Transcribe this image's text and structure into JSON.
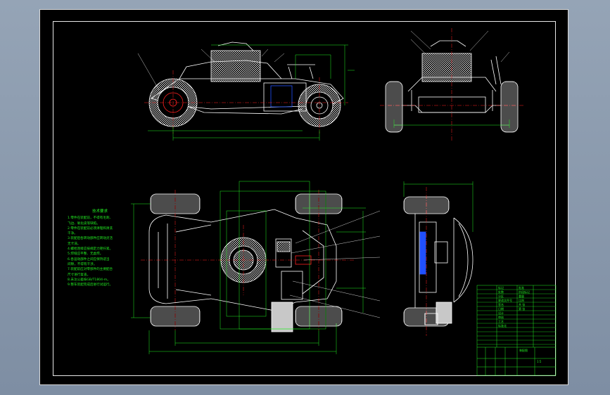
{
  "drawing": {
    "technical_notes": {
      "title": "技术要求",
      "lines": [
        "1.零件在装配前，不得有毛刺、",
        "  飞边、氧化皮等缺陷。",
        "2.零件在装配前必须清理和清洗",
        "  干净。",
        "3.装配后各转动部件应转动灵活",
        "  无卡滞。",
        "4.螺栓连接应按规定力矩拧紧。",
        "5.焊缝应平整、无虚焊。",
        "6.各运动部件之间应保持适当",
        "  间隙，不得有干涉。",
        "7.装配前应对零部件的主要配合",
        "  尺寸进行复查。",
        "8.未注公差按GB/T1804-m。",
        "9.整车装配完成后进行试运行。"
      ]
    },
    "title_block": {
      "labels": [
        "标记",
        "处数",
        "分区",
        "更改文件号",
        "签名",
        "日期",
        "设计",
        "审核",
        "工艺",
        "标准化",
        "批准",
        "阶段标记",
        "重量",
        "比例",
        "共 张",
        "第 张"
      ],
      "drawing_no": "装配图",
      "scale": "1:5"
    },
    "colors": {
      "background": "#000000",
      "outline": "#ffffff",
      "dimension": "#22ee22",
      "centerline": "#ff2020",
      "hidden": "#2050ff",
      "border": "#e8e8e8"
    }
  }
}
